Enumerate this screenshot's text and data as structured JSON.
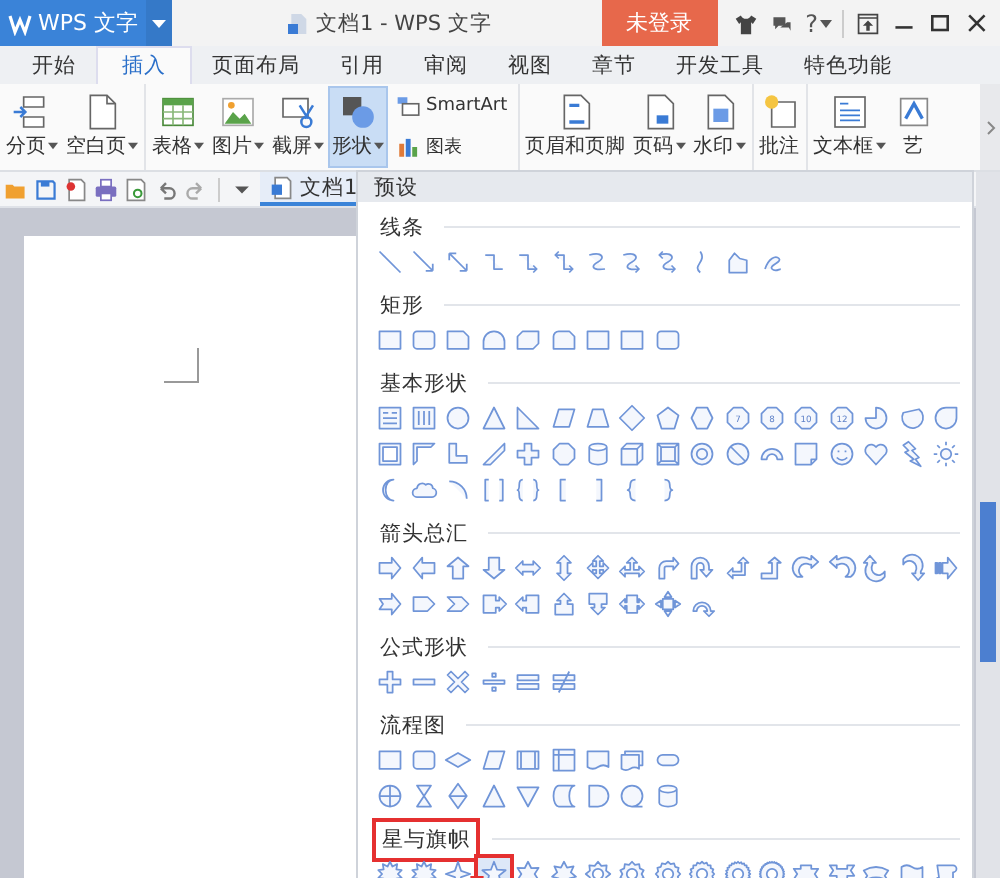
{
  "app_button": {
    "label": "WPS 文字"
  },
  "window": {
    "title": "文档1 - WPS 文字"
  },
  "login_button": {
    "label": "未登录"
  },
  "help_button": {
    "label": "?"
  },
  "tabs": [
    {
      "label": "开始",
      "selected": false
    },
    {
      "label": "插入",
      "selected": true
    },
    {
      "label": "页面布局",
      "selected": false
    },
    {
      "label": "引用",
      "selected": false
    },
    {
      "label": "审阅",
      "selected": false
    },
    {
      "label": "视图",
      "selected": false
    },
    {
      "label": "章节",
      "selected": false
    },
    {
      "label": "开发工具",
      "selected": false
    },
    {
      "label": "特色功能",
      "selected": false
    }
  ],
  "ribbon": {
    "groups": [
      {
        "items": [
          {
            "kind": "page-break",
            "label": "分页",
            "dropdown": true,
            "selected": false
          },
          {
            "kind": "blank-page",
            "label": "空白页",
            "dropdown": true,
            "selected": false
          }
        ]
      },
      {
        "items": [
          {
            "kind": "table",
            "label": "表格",
            "dropdown": true,
            "selected": false
          },
          {
            "kind": "picture",
            "label": "图片",
            "dropdown": true,
            "selected": false
          },
          {
            "kind": "screenshot",
            "label": "截屏",
            "dropdown": true,
            "selected": false
          },
          {
            "kind": "shapes",
            "label": "形状",
            "dropdown": true,
            "selected": true
          }
        ],
        "stack": [
          {
            "kind": "smartart",
            "label": "SmartArt",
            "selected": false
          },
          {
            "kind": "chart",
            "label": "图表",
            "selected": false
          }
        ]
      },
      {
        "items": [
          {
            "kind": "header-footer",
            "label": "页眉和页脚",
            "dropdown": false,
            "selected": false
          },
          {
            "kind": "page-number",
            "label": "页码",
            "dropdown": true,
            "selected": false
          },
          {
            "kind": "watermark",
            "label": "水印",
            "dropdown": true,
            "selected": false
          }
        ]
      },
      {
        "items": [
          {
            "kind": "comment",
            "label": "批注",
            "dropdown": false,
            "selected": false
          }
        ]
      },
      {
        "items": [
          {
            "kind": "text-box",
            "label": "文本框",
            "dropdown": true,
            "selected": false
          },
          {
            "kind": "art-text",
            "label": "艺",
            "dropdown": false,
            "selected": false
          }
        ]
      }
    ]
  },
  "document_tab": {
    "label": "文档1",
    "selected": true
  },
  "shapes_menu": {
    "header": "预设",
    "sections": [
      {
        "title": "线条",
        "highlighted": false,
        "rows": [
          [
            {
              "kind": "line",
              "highlighted": false
            },
            {
              "kind": "arrow-line",
              "highlighted": false
            },
            {
              "kind": "double-arrow-line",
              "highlighted": false
            },
            {
              "kind": "elbow",
              "highlighted": false
            },
            {
              "kind": "elbow-arrow",
              "highlighted": false
            },
            {
              "kind": "elbow-double-arrow",
              "highlighted": false
            },
            {
              "kind": "curve",
              "highlighted": false
            },
            {
              "kind": "curve-arrow",
              "highlighted": false
            },
            {
              "kind": "curve-double-arrow",
              "highlighted": false
            },
            {
              "kind": "freeform-curve",
              "highlighted": false
            },
            {
              "kind": "freeform",
              "highlighted": false
            },
            {
              "kind": "scribble",
              "highlighted": false
            }
          ]
        ]
      },
      {
        "title": "矩形",
        "highlighted": false,
        "rows": [
          [
            {
              "kind": "rect",
              "highlighted": false
            },
            {
              "kind": "round-rect",
              "highlighted": false
            },
            {
              "kind": "snip-rect",
              "highlighted": false
            },
            {
              "kind": "round-top-rect",
              "highlighted": false
            },
            {
              "kind": "snip-corner-rect",
              "highlighted": false
            },
            {
              "kind": "round-snip-rect",
              "highlighted": false
            },
            {
              "kind": "rect",
              "highlighted": false
            },
            {
              "kind": "rect",
              "highlighted": false
            },
            {
              "kind": "round-rect",
              "highlighted": false
            }
          ]
        ]
      },
      {
        "title": "基本形状",
        "highlighted": false,
        "rows": [
          [
            {
              "kind": "text-box",
              "highlighted": false
            },
            {
              "kind": "vertical-text-box",
              "highlighted": false
            },
            {
              "kind": "circle",
              "highlighted": false
            },
            {
              "kind": "triangle",
              "highlighted": false
            },
            {
              "kind": "right-triangle",
              "highlighted": false
            },
            {
              "kind": "parallelogram",
              "highlighted": false
            },
            {
              "kind": "trapezoid",
              "highlighted": false
            },
            {
              "kind": "diamond",
              "highlighted": false
            },
            {
              "kind": "pentagon",
              "highlighted": false
            },
            {
              "kind": "hexagon",
              "highlighted": false
            },
            {
              "kind": "octagon-number",
              "label": "7",
              "highlighted": false
            },
            {
              "kind": "octagon-number",
              "label": "8",
              "highlighted": false
            },
            {
              "kind": "octagon-number",
              "label": "10",
              "highlighted": false
            },
            {
              "kind": "octagon-number",
              "label": "12",
              "highlighted": false
            },
            {
              "kind": "pie",
              "highlighted": false
            },
            {
              "kind": "chord",
              "highlighted": false
            },
            {
              "kind": "teardrop",
              "highlighted": false
            }
          ],
          [
            {
              "kind": "frame",
              "highlighted": false
            },
            {
              "kind": "half-frame",
              "highlighted": false
            },
            {
              "kind": "l-shape",
              "highlighted": false
            },
            {
              "kind": "diagonal-stripe",
              "highlighted": false
            },
            {
              "kind": "cross",
              "highlighted": false
            },
            {
              "kind": "octagon",
              "highlighted": false
            },
            {
              "kind": "cylinder",
              "highlighted": false
            },
            {
              "kind": "cube",
              "highlighted": false
            },
            {
              "kind": "bevel",
              "highlighted": false
            },
            {
              "kind": "donut",
              "highlighted": false
            },
            {
              "kind": "no-symbol",
              "highlighted": false
            },
            {
              "kind": "block-arc",
              "highlighted": false
            },
            {
              "kind": "folded-corner",
              "highlighted": false
            },
            {
              "kind": "smiley",
              "highlighted": false
            },
            {
              "kind": "heart",
              "highlighted": false
            },
            {
              "kind": "lightning",
              "highlighted": false
            },
            {
              "kind": "sun",
              "highlighted": false
            }
          ],
          [
            {
              "kind": "moon",
              "highlighted": false
            },
            {
              "kind": "cloud",
              "highlighted": false
            },
            {
              "kind": "arc",
              "highlighted": false
            },
            {
              "kind": "double-bracket",
              "highlighted": false
            },
            {
              "kind": "double-brace",
              "highlighted": false
            },
            {
              "kind": "left-bracket",
              "highlighted": false
            },
            {
              "kind": "right-bracket",
              "highlighted": false
            },
            {
              "kind": "left-brace",
              "highlighted": false
            },
            {
              "kind": "right-brace",
              "highlighted": false
            }
          ]
        ]
      },
      {
        "title": "箭头总汇",
        "highlighted": false,
        "rows": [
          [
            {
              "kind": "arrow-right",
              "highlighted": false
            },
            {
              "kind": "arrow-left",
              "highlighted": false
            },
            {
              "kind": "arrow-up",
              "highlighted": false
            },
            {
              "kind": "arrow-down",
              "highlighted": false
            },
            {
              "kind": "arrow-left-right",
              "highlighted": false
            },
            {
              "kind": "arrow-up-down",
              "highlighted": false
            },
            {
              "kind": "arrow-quad",
              "highlighted": false
            },
            {
              "kind": "arrow-left-right-up",
              "highlighted": false
            },
            {
              "kind": "bent-arrow",
              "highlighted": false
            },
            {
              "kind": "u-turn-arrow",
              "highlighted": false
            },
            {
              "kind": "left-up-arrow",
              "highlighted": false
            },
            {
              "kind": "bent-up-arrow",
              "highlighted": false
            },
            {
              "kind": "curved-right-arrow",
              "highlighted": false
            },
            {
              "kind": "curved-left-arrow",
              "highlighted": false
            },
            {
              "kind": "curved-up-arrow",
              "highlighted": false
            },
            {
              "kind": "curved-down-arrow",
              "highlighted": false
            },
            {
              "kind": "striped-right-arrow",
              "highlighted": false
            }
          ],
          [
            {
              "kind": "notched-right-arrow",
              "highlighted": false
            },
            {
              "kind": "pentagon-arrow",
              "highlighted": false
            },
            {
              "kind": "chevron",
              "highlighted": false
            },
            {
              "kind": "callout-right",
              "highlighted": false
            },
            {
              "kind": "callout-left",
              "highlighted": false
            },
            {
              "kind": "callout-up",
              "highlighted": false
            },
            {
              "kind": "callout-down",
              "highlighted": false
            },
            {
              "kind": "callout-left-right",
              "highlighted": false
            },
            {
              "kind": "callout-quad",
              "highlighted": false
            },
            {
              "kind": "circular-arrow",
              "highlighted": false
            }
          ]
        ]
      },
      {
        "title": "公式形状",
        "highlighted": false,
        "rows": [
          [
            {
              "kind": "plus",
              "highlighted": false
            },
            {
              "kind": "minus",
              "highlighted": false
            },
            {
              "kind": "multiply",
              "highlighted": false
            },
            {
              "kind": "divide",
              "highlighted": false
            },
            {
              "kind": "equal",
              "highlighted": false
            },
            {
              "kind": "not-equal",
              "highlighted": false
            }
          ]
        ]
      },
      {
        "title": "流程图",
        "highlighted": false,
        "rows": [
          [
            {
              "kind": "rect",
              "highlighted": false
            },
            {
              "kind": "round-rect",
              "highlighted": false
            },
            {
              "kind": "flow-decision",
              "highlighted": false
            },
            {
              "kind": "parallelogram",
              "highlighted": false
            },
            {
              "kind": "flow-predefined",
              "highlighted": false
            },
            {
              "kind": "flow-internal",
              "highlighted": false
            },
            {
              "kind": "flow-document",
              "highlighted": false
            },
            {
              "kind": "flow-multidocument",
              "highlighted": false
            },
            {
              "kind": "flow-terminator",
              "highlighted": false
            }
          ],
          [
            {
              "kind": "summing-junction",
              "highlighted": false
            },
            {
              "kind": "collate",
              "highlighted": false
            },
            {
              "kind": "sort",
              "highlighted": false
            },
            {
              "kind": "triangle",
              "highlighted": false
            },
            {
              "kind": "merge",
              "highlighted": false
            },
            {
              "kind": "stored-data",
              "highlighted": false
            },
            {
              "kind": "delay",
              "highlighted": false
            },
            {
              "kind": "sequential",
              "highlighted": false
            },
            {
              "kind": "cylinder",
              "highlighted": false
            }
          ]
        ]
      },
      {
        "title": "星与旗帜",
        "highlighted": true,
        "rows": [
          [
            {
              "kind": "burst",
              "highlighted": false
            },
            {
              "kind": "burst",
              "highlighted": false
            },
            {
              "kind": "star-4",
              "highlighted": false
            },
            {
              "kind": "star-5",
              "highlighted": true
            },
            {
              "kind": "star-6",
              "highlighted": false
            },
            {
              "kind": "star-7",
              "highlighted": false
            },
            {
              "kind": "star-8",
              "highlighted": false
            },
            {
              "kind": "star-10",
              "highlighted": false
            },
            {
              "kind": "star-12",
              "highlighted": false
            },
            {
              "kind": "star-16",
              "highlighted": false
            },
            {
              "kind": "star-24",
              "highlighted": false
            },
            {
              "kind": "star-32",
              "highlighted": false
            },
            {
              "kind": "ribbon-up",
              "highlighted": false
            },
            {
              "kind": "ribbon-down",
              "highlighted": false
            },
            {
              "kind": "curved-ribbon",
              "highlighted": false
            },
            {
              "kind": "wave",
              "highlighted": false
            },
            {
              "kind": "scroll",
              "highlighted": false
            }
          ]
        ]
      }
    ]
  }
}
